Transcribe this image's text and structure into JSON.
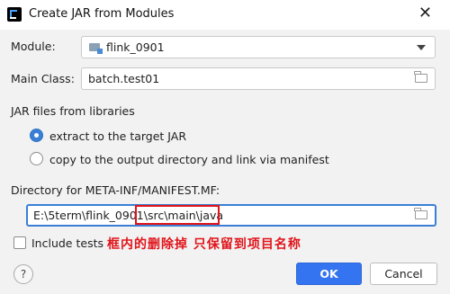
{
  "window": {
    "title": "Create JAR from Modules",
    "close_label": "✕"
  },
  "module": {
    "label": "Module:",
    "value": "flink_0901"
  },
  "main_class": {
    "label": "Main Class:",
    "value": "batch.test01"
  },
  "jar_files": {
    "section_label": "JAR files from libraries",
    "option_extract": "extract to the target JAR",
    "option_copy": "copy to the output directory and link via manifest",
    "selected": "extract"
  },
  "directory": {
    "label": "Directory for META-INF/MANIFEST.MF:",
    "value_prefix": "E:\\5term\\flink_0901",
    "value_suffix": "\\src\\main\\java"
  },
  "include_tests": {
    "label": "Include tests",
    "checked": false
  },
  "annotation": {
    "text": "框内的删除掉 只保留到项目名称"
  },
  "buttons": {
    "help": "?",
    "ok": "OK",
    "cancel": "Cancel"
  }
}
